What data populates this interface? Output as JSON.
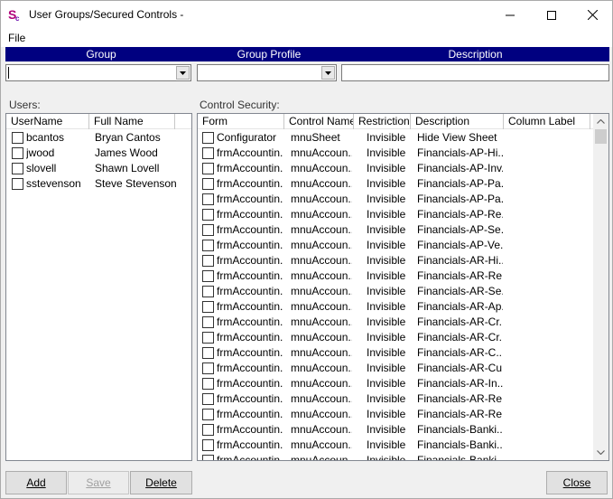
{
  "window": {
    "title": "User Groups/Secured Controls -"
  },
  "menu": {
    "file": "File"
  },
  "group_header": {
    "group": "Group",
    "group_profile": "Group Profile",
    "description": "Description"
  },
  "filters": {
    "group_value": "",
    "group_profile_value": "",
    "description_value": ""
  },
  "users": {
    "label": "Users:",
    "columns": [
      "UserName",
      "Full Name"
    ],
    "rows": [
      {
        "username": "bcantos",
        "fullname": "Bryan Cantos"
      },
      {
        "username": "jwood",
        "fullname": "James Wood"
      },
      {
        "username": "slovell",
        "fullname": "Shawn Lovell"
      },
      {
        "username": "sstevenson",
        "fullname": "Steve Stevenson"
      }
    ]
  },
  "control_security": {
    "label": "Control Security:",
    "columns": [
      "Form",
      "Control Name",
      "Restriction",
      "Description",
      "Column Label"
    ],
    "rows": [
      {
        "form": "Configurator",
        "control": "mnuSheet",
        "restriction": "Invisible",
        "description": "Hide View Sheet"
      },
      {
        "form": "frmAccountin...",
        "control": "mnuAccoun...",
        "restriction": "Invisible",
        "description": "Financials-AP-Hi..."
      },
      {
        "form": "frmAccountin...",
        "control": "mnuAccoun...",
        "restriction": "Invisible",
        "description": "Financials-AP-Inv..."
      },
      {
        "form": "frmAccountin...",
        "control": "mnuAccoun...",
        "restriction": "Invisible",
        "description": "Financials-AP-Pa..."
      },
      {
        "form": "frmAccountin...",
        "control": "mnuAccoun...",
        "restriction": "Invisible",
        "description": "Financials-AP-Pa..."
      },
      {
        "form": "frmAccountin...",
        "control": "mnuAccoun...",
        "restriction": "Invisible",
        "description": "Financials-AP-Re..."
      },
      {
        "form": "frmAccountin...",
        "control": "mnuAccoun...",
        "restriction": "Invisible",
        "description": "Financials-AP-Se..."
      },
      {
        "form": "frmAccountin...",
        "control": "mnuAccoun...",
        "restriction": "Invisible",
        "description": "Financials-AP-Ve..."
      },
      {
        "form": "frmAccountin...",
        "control": "mnuAccoun...",
        "restriction": "Invisible",
        "description": "Financials-AR-Hi..."
      },
      {
        "form": "frmAccountin...",
        "control": "mnuAccoun...",
        "restriction": "Invisible",
        "description": "Financials-AR-Re..."
      },
      {
        "form": "frmAccountin...",
        "control": "mnuAccoun...",
        "restriction": "Invisible",
        "description": "Financials-AR-Se..."
      },
      {
        "form": "frmAccountin...",
        "control": "mnuAccoun...",
        "restriction": "Invisible",
        "description": "Financials-AR-Ap..."
      },
      {
        "form": "frmAccountin...",
        "control": "mnuAccoun...",
        "restriction": "Invisible",
        "description": "Financials-AR-Cr..."
      },
      {
        "form": "frmAccountin...",
        "control": "mnuAccoun...",
        "restriction": "Invisible",
        "description": "Financials-AR-Cr..."
      },
      {
        "form": "frmAccountin...",
        "control": "mnuAccoun...",
        "restriction": "Invisible",
        "description": "Financials-AR-C..."
      },
      {
        "form": "frmAccountin...",
        "control": "mnuAccoun...",
        "restriction": "Invisible",
        "description": "Financials-AR-Cu..."
      },
      {
        "form": "frmAccountin...",
        "control": "mnuAccoun...",
        "restriction": "Invisible",
        "description": "Financials-AR-In..."
      },
      {
        "form": "frmAccountin...",
        "control": "mnuAccoun...",
        "restriction": "Invisible",
        "description": "Financials-AR-Re..."
      },
      {
        "form": "frmAccountin...",
        "control": "mnuAccoun...",
        "restriction": "Invisible",
        "description": "Financials-AR-Re..."
      },
      {
        "form": "frmAccountin...",
        "control": "mnuAccoun...",
        "restriction": "Invisible",
        "description": "Financials-Banki..."
      },
      {
        "form": "frmAccountin...",
        "control": "mnuAccoun...",
        "restriction": "Invisible",
        "description": "Financials-Banki..."
      },
      {
        "form": "frmAccountin...",
        "control": "mnuAccoun...",
        "restriction": "Invisible",
        "description": "Financials-Banki..."
      }
    ]
  },
  "buttons": {
    "add": "Add",
    "save": "Save",
    "delete": "Delete",
    "close": "Close"
  },
  "colors": {
    "header_bar": "#000080",
    "icon_accent": "#b0007a"
  }
}
